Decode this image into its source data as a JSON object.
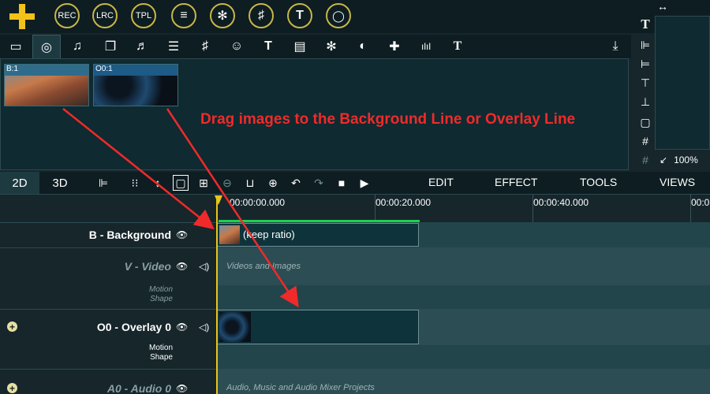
{
  "toolbar": {
    "add_icon": "plus-icon",
    "buttons": [
      {
        "label": "REC"
      },
      {
        "label": "LRC"
      },
      {
        "label": "TPL"
      },
      {
        "label": "≡"
      },
      {
        "label": "✻"
      },
      {
        "label": "♯"
      },
      {
        "label": "T"
      },
      {
        "label": "◯"
      }
    ]
  },
  "media_tabs": [
    "▭",
    "◎",
    "♫",
    "❐",
    "♬",
    "☰",
    "♯",
    "☺",
    "T",
    "▤",
    "✻",
    "◐",
    "✚",
    "ılıl",
    "T",
    "⤓"
  ],
  "media": {
    "items": [
      {
        "label": "B:1"
      },
      {
        "label": "O0:1"
      }
    ],
    "hint": "Drag images to the Background Line or Overlay Line"
  },
  "side_icons": [
    "T",
    "⊫",
    "⊨",
    "⊤",
    "⊥",
    "▢",
    "#",
    "#"
  ],
  "resize_icon": "↔",
  "zoom": {
    "value": "100%",
    "icon": "↙"
  },
  "timeline_modes": [
    "2D",
    "3D"
  ],
  "timeline_tools": [
    "⊫",
    "⁝⁝",
    "↕",
    "▢",
    "⊞",
    "⊖",
    "⊔",
    "⊕",
    "↶",
    "↷",
    "■",
    "▶"
  ],
  "menus": [
    "EDIT",
    "EFFECT",
    "TOOLS",
    "VIEWS"
  ],
  "ruler": {
    "labels": [
      "00:00:00.000",
      "00:00:20.000",
      "00:00:40.000",
      "00:0"
    ]
  },
  "tracks": [
    {
      "name": "B - Background",
      "style": "bold",
      "clip_label": "(keep ratio)"
    },
    {
      "name": "V - Video",
      "style": "dim",
      "hint": "Videos and Images",
      "sub": [
        "Motion",
        "Shape"
      ]
    },
    {
      "name": "O0 - Overlay 0",
      "style": "bold",
      "sub": [
        "Motion",
        "Shape"
      ]
    },
    {
      "name": "A0 - Audio 0",
      "style": "dim",
      "hint": "Audio, Music and Audio Mixer Projects"
    }
  ],
  "colors": {
    "accent": "#f3c21a",
    "hint_red": "#f02a2a",
    "progress_green": "#1ed04a"
  }
}
